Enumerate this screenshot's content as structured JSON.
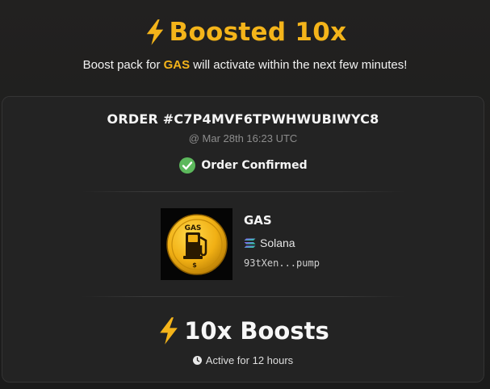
{
  "header": {
    "title": "Boosted 10x",
    "subtitle_prefix": "Boost pack for ",
    "subtitle_token": "GAS",
    "subtitle_suffix": " will activate within the next few minutes!"
  },
  "order": {
    "id_label": "ORDER #C7P4MVF6TPWHWUBIWYC8",
    "timestamp": "@ Mar 28th 16:23 UTC",
    "status": "Order Confirmed"
  },
  "token": {
    "name": "GAS",
    "image_text": "GAS",
    "chain": "Solana",
    "address": "93tXen...pump"
  },
  "boost": {
    "label": "10x Boosts",
    "duration": "Active for 12 hours"
  },
  "icons": {
    "title": "lightning-bolt-icon",
    "status": "check-circle-icon",
    "chain": "solana-icon",
    "boost": "lightning-bolt-icon",
    "duration": "clock-icon"
  },
  "colors": {
    "accent": "#f4b41a",
    "success": "#5cb85c",
    "background": "#1e1e1e",
    "card": "#232323"
  }
}
